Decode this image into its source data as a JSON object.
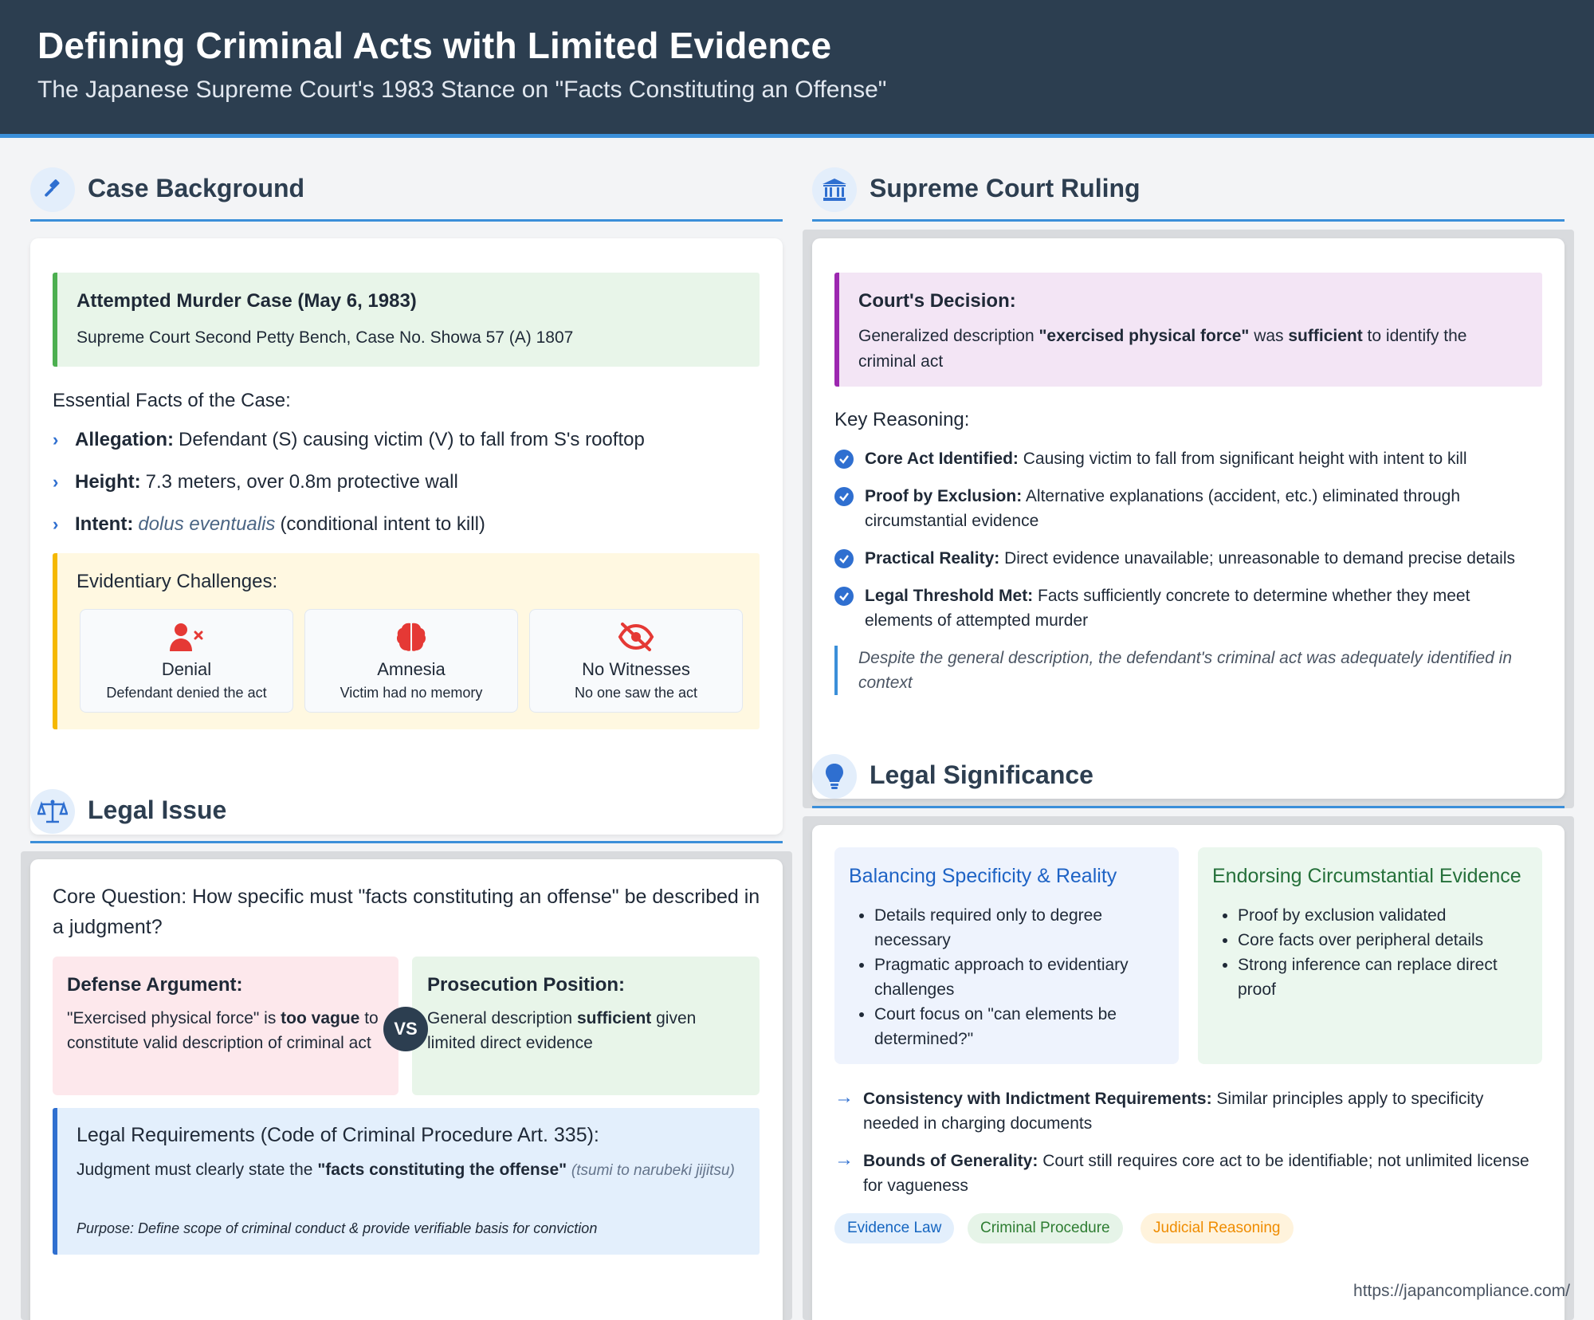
{
  "header": {
    "title": "Defining Criminal Acts with Limited Evidence",
    "subtitle": "The Japanese Supreme Court's 1983 Stance on \"Facts Constituting an Offense\""
  },
  "sections": {
    "case_background": "Case Background",
    "supreme_court_ruling": "Supreme Court Ruling",
    "legal_issue": "Legal Issue",
    "legal_significance": "Legal Significance"
  },
  "case": {
    "title": "Attempted Murder Case (May 6, 1983)",
    "subtitle": "Supreme Court Second Petty Bench, Case No. Showa 57 (A) 1807",
    "facts_title": "Essential Facts of the Case:",
    "facts": [
      {
        "label": "Allegation:",
        "text": "Defendant (S) causing victim (V) to fall from S's rooftop"
      },
      {
        "label": "Height:",
        "text": "7.3 meters, over 0.8m protective wall"
      },
      {
        "label": "Intent:",
        "latin": "dolus eventualis",
        "text": "(conditional intent to kill)"
      }
    ],
    "challenges_title": "Evidentiary Challenges:",
    "challenges": [
      {
        "icon": "user-x-icon",
        "name": "Denial",
        "desc": "Defendant denied the act"
      },
      {
        "icon": "brain-icon",
        "name": "Amnesia",
        "desc": "Victim had no memory"
      },
      {
        "icon": "eye-slash-icon",
        "name": "No Witnesses",
        "desc": "No one saw the act"
      }
    ]
  },
  "issue": {
    "core_question": "Core Question: How specific must \"facts constituting an offense\" be described in a judgment?",
    "defense": {
      "title": "Defense Argument:",
      "pre": "\"Exercised physical force\" is ",
      "bold": "too vague",
      "post": " to constitute valid description of criminal act"
    },
    "vs": "VS",
    "prosecution": {
      "title": "Prosecution Position:",
      "pre": "General description ",
      "bold": "sufficient",
      "post": " given limited direct evidence"
    },
    "requirements": {
      "title": "Legal Requirements (Code of Criminal Procedure Art. 335):",
      "pre": "Judgment must clearly state the ",
      "bold": "\"facts constituting the offense\"",
      "italic": "(tsumi to narubeki jijitsu)",
      "purpose": "Purpose: Define scope of criminal conduct & provide verifiable basis for conviction"
    }
  },
  "ruling": {
    "decision_title": "Court's Decision:",
    "decision_pre": "Generalized description ",
    "decision_bold1": "\"exercised physical force\"",
    "decision_mid": " was ",
    "decision_bold2": "sufficient",
    "decision_post": " to identify the criminal act",
    "key_title": "Key Reasoning:",
    "reasons": [
      {
        "label": "Core Act Identified:",
        "text": "Causing victim to fall from significant height with intent to kill"
      },
      {
        "label": "Proof by Exclusion:",
        "text": "Alternative explanations (accident, etc.) eliminated through circumstantial evidence"
      },
      {
        "label": "Practical Reality:",
        "text": "Direct evidence unavailable; unreasonable to demand precise details"
      },
      {
        "label": "Legal Threshold Met:",
        "text": "Facts sufficiently concrete to determine whether they meet elements of attempted murder"
      }
    ],
    "quote": "Despite the general description, the defendant's criminal act was adequately identified in context"
  },
  "significance": {
    "cards": [
      {
        "title": "Balancing Specificity & Reality",
        "items": [
          "Details required only to degree necessary",
          "Pragmatic approach to evidentiary challenges",
          "Court focus on \"can elements be determined?\""
        ]
      },
      {
        "title": "Endorsing Circumstantial Evidence",
        "items": [
          "Proof by exclusion validated",
          "Core facts over peripheral details",
          "Strong inference can replace direct proof"
        ]
      }
    ],
    "points": [
      {
        "label": "Consistency with Indictment Requirements:",
        "text": "Similar principles apply to specificity needed in charging documents"
      },
      {
        "label": "Bounds of Generality:",
        "text": "Court still requires core act to be identifiable; not unlimited license for vagueness"
      }
    ],
    "tags": [
      "Evidence Law",
      "Criminal Procedure",
      "Judicial Reasoning"
    ]
  },
  "footer": {
    "url": "https://japancompliance.com/"
  },
  "colors": {
    "header": "#2c3e50",
    "accent": "#3b8fd9",
    "tag_blue": "#1565c0",
    "tag_green": "#2e7d32",
    "tag_orange": "#ef8c00"
  }
}
